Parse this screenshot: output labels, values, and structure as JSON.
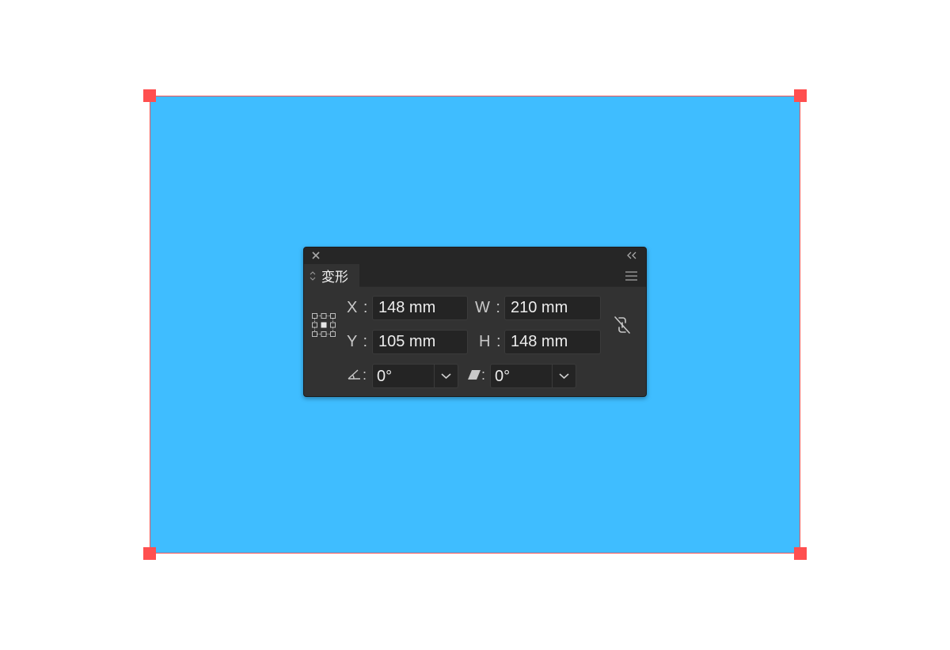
{
  "canvas": {
    "artboard_color": "#3fbdff",
    "selection_color": "#ff4f4f"
  },
  "panel": {
    "close_icon": "close-icon",
    "collapse_icon": "double-chevron-left-icon",
    "tab_label": "変形",
    "menu_icon": "hamburger-menu-icon",
    "fields": {
      "x": {
        "label": "X :",
        "value": "148 mm"
      },
      "y": {
        "label": "Y :",
        "value": "105 mm"
      },
      "w": {
        "label": "W :",
        "value": "210 mm"
      },
      "h": {
        "label": "H :",
        "value": "148 mm"
      },
      "rotate": {
        "label": ":",
        "value": "0°",
        "icon": "rotate-angle-icon"
      },
      "shear": {
        "label": ":",
        "value": "0°",
        "icon": "shear-icon"
      }
    },
    "constrain_icon": "unlinked-proportions-icon",
    "reference_point_icon": "reference-point-grid-icon"
  }
}
